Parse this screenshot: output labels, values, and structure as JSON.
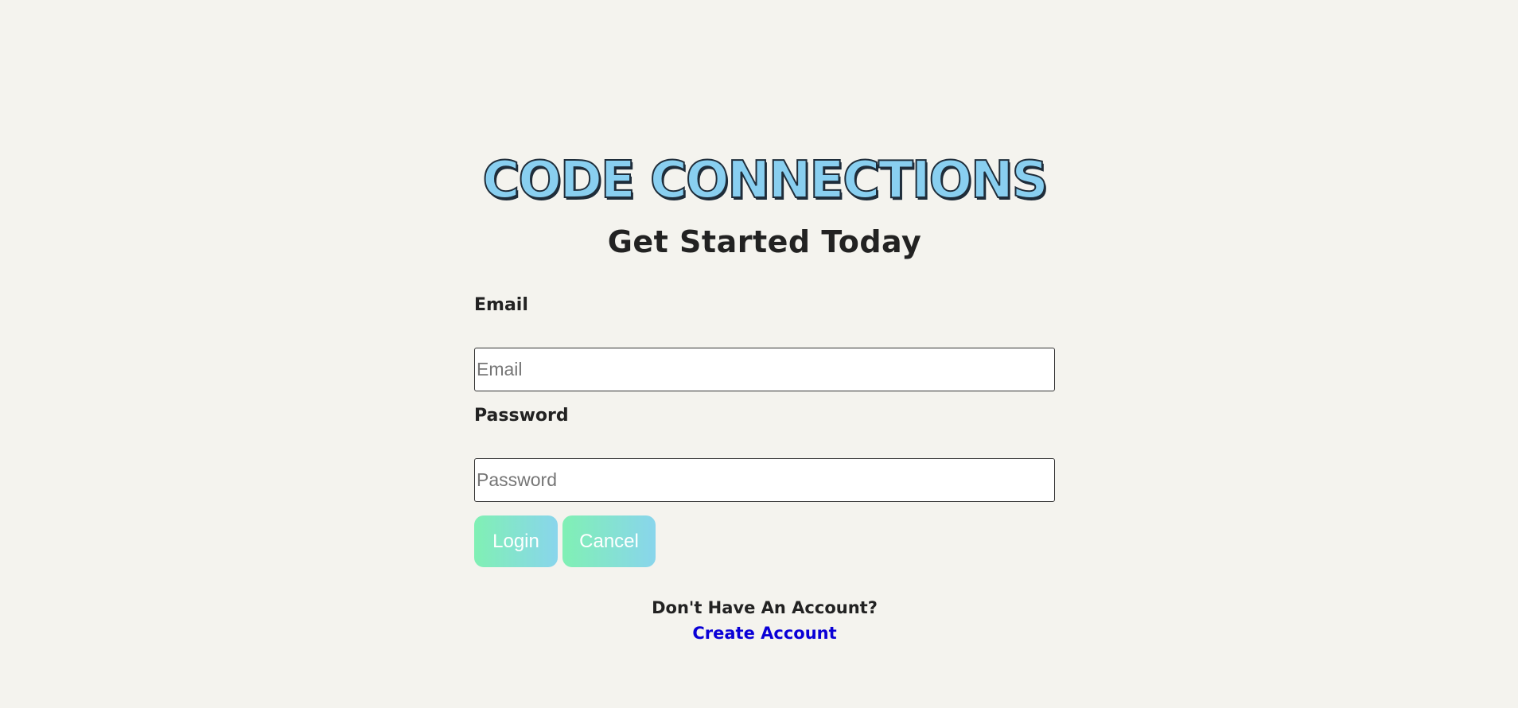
{
  "header": {
    "app_title": "CODE CONNECTIONS",
    "subtitle": "Get Started Today"
  },
  "form": {
    "email": {
      "label": "Email",
      "placeholder": "Email",
      "value": ""
    },
    "password": {
      "label": "Password",
      "placeholder": "Password",
      "value": ""
    },
    "login_label": "Login",
    "cancel_label": "Cancel"
  },
  "signup": {
    "prompt": "Don't Have An Account?",
    "link_label": "Create Account"
  },
  "colors": {
    "background": "#f4f3ee",
    "title_fill": "#89cff0",
    "button_gradient_start": "#80f0b4",
    "button_gradient_end": "#89d5ec",
    "link": "#0a00d6"
  }
}
